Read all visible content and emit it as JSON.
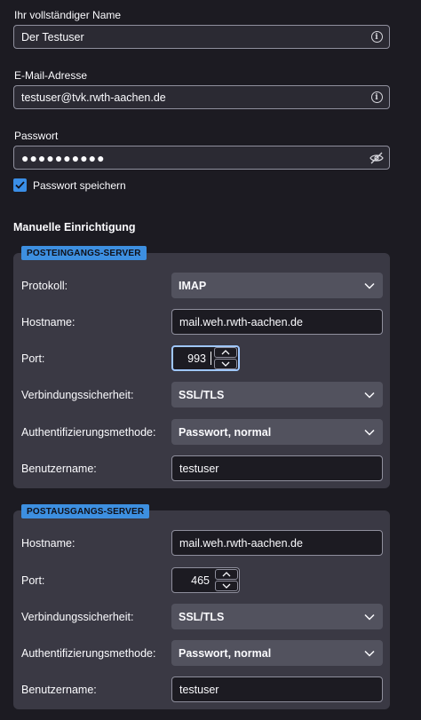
{
  "account": {
    "name_label": "Ihr vollständiger Name",
    "name_value": "Der Testuser",
    "email_label": "E-Mail-Adresse",
    "email_value": "testuser@tvk.rwth-aachen.de",
    "password_label": "Passwort",
    "password_value": "●●●●●●●●●●",
    "remember_password_label": "Passwort speichern",
    "remember_password_checked": true
  },
  "manual_setup": {
    "title": "Manuelle Einrichtigung",
    "incoming": {
      "tag": "POSTEINGANGS-SERVER",
      "protocol_label": "Protokoll:",
      "protocol_value": "IMAP",
      "hostname_label": "Hostname:",
      "hostname_value": "mail.weh.rwth-aachen.de",
      "port_label": "Port:",
      "port_value": "993",
      "security_label": "Verbindungssicherheit:",
      "security_value": "SSL/TLS",
      "auth_label": "Authentifizierungsmethode:",
      "auth_value": "Passwort, normal",
      "username_label": "Benutzername:",
      "username_value": "testuser"
    },
    "outgoing": {
      "tag": "POSTAUSGANGS-SERVER",
      "hostname_label": "Hostname:",
      "hostname_value": "mail.weh.rwth-aachen.de",
      "port_label": "Port:",
      "port_value": "465",
      "security_label": "Verbindungssicherheit:",
      "security_value": "SSL/TLS",
      "auth_label": "Authentifizierungsmethode:",
      "auth_value": "Passwort, normal",
      "username_label": "Benutzername:",
      "username_value": "testuser"
    }
  },
  "icons": {
    "info": "info-icon",
    "password_visibility": "eye-slash-icon",
    "dropdown": "chevron-down-icon",
    "spin_up": "chevron-up-icon",
    "spin_down": "chevron-down-icon",
    "check": "checkmark-icon"
  },
  "colors": {
    "background": "#1c1b22",
    "panel": "#3a3944",
    "accent": "#3d8fe0",
    "focus_ring": "#9fc7ff"
  }
}
